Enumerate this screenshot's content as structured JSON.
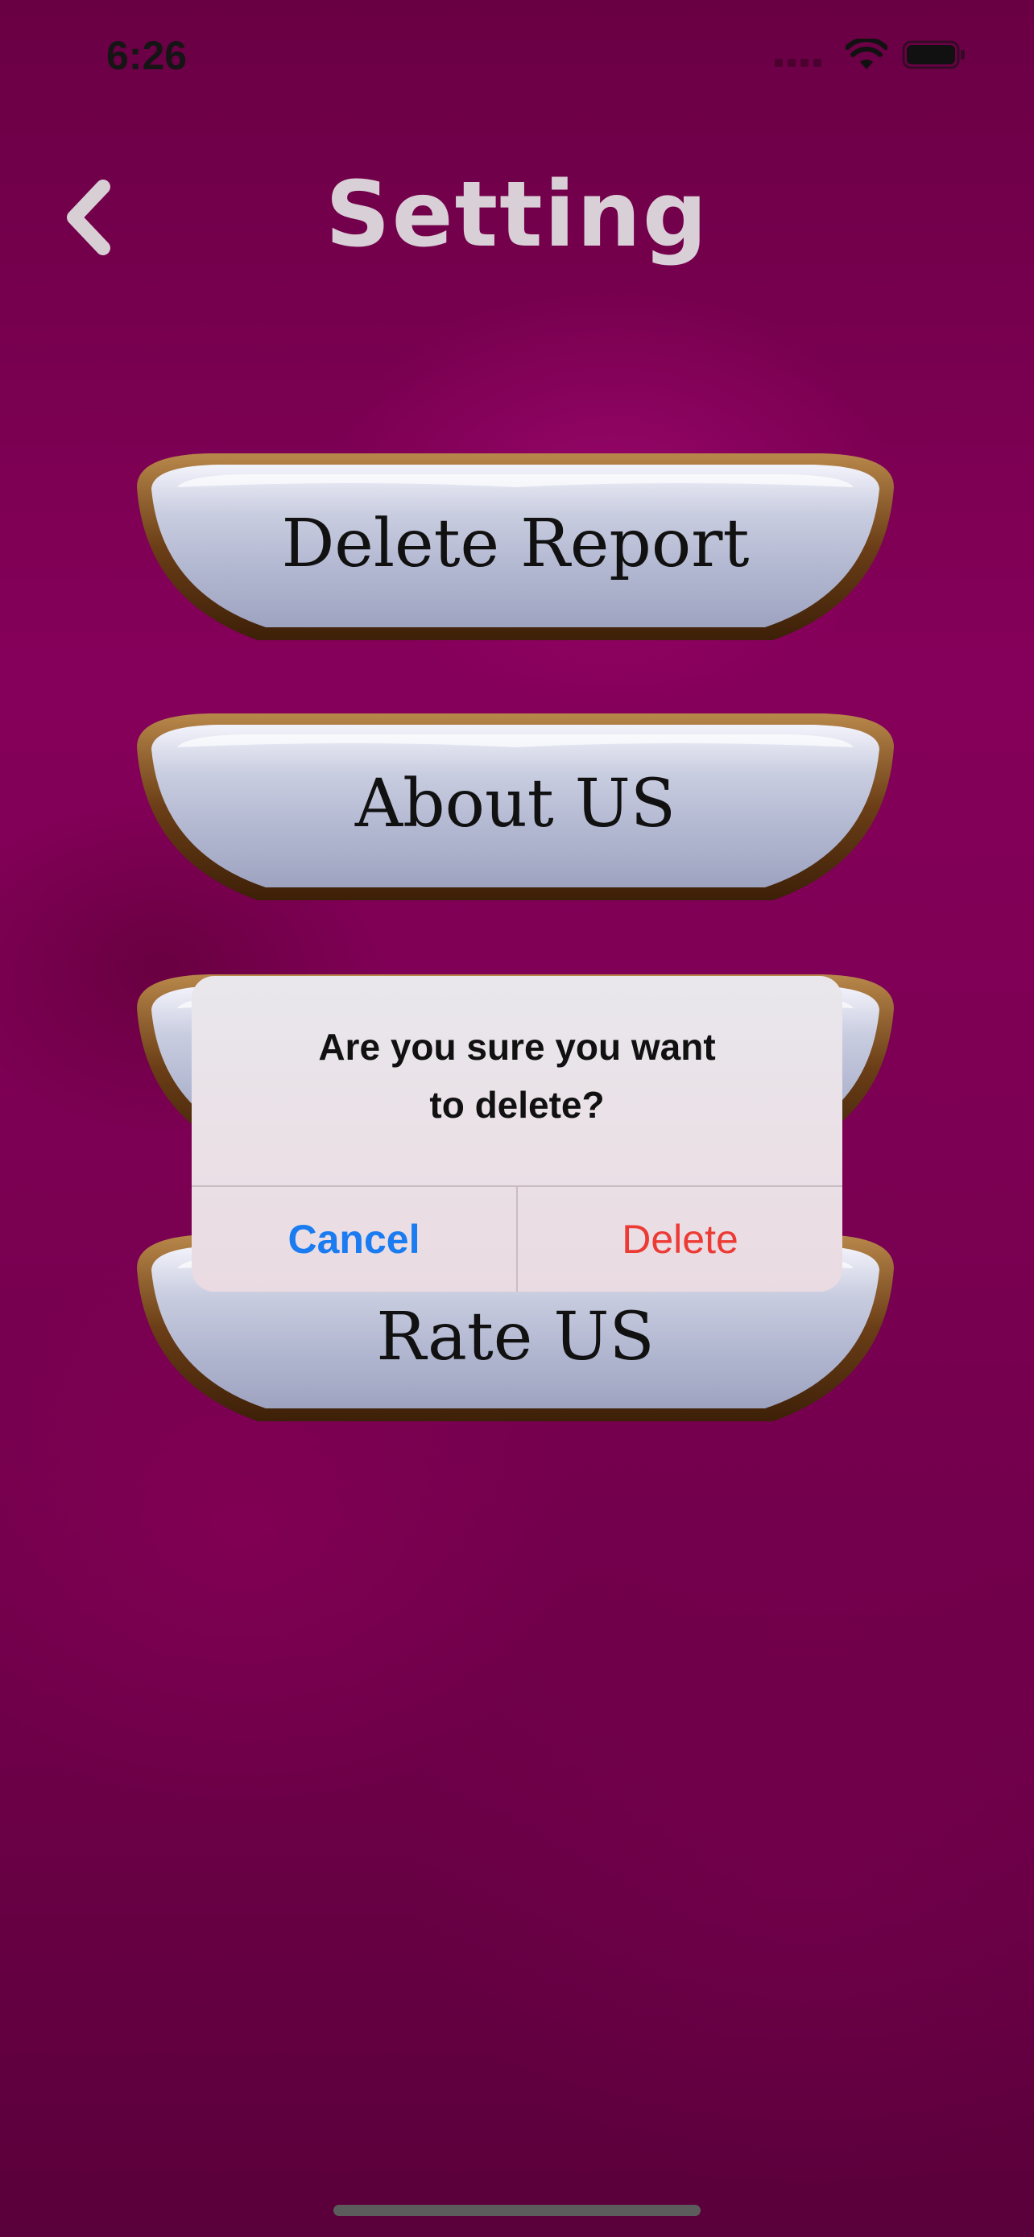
{
  "status_bar": {
    "time": "6:26"
  },
  "header": {
    "title": "Setting"
  },
  "menu": {
    "items": [
      {
        "label": "Delete Report"
      },
      {
        "label": "About US"
      },
      {
        "label": ""
      },
      {
        "label": "Rate US"
      }
    ]
  },
  "alert": {
    "message_line1": "Are you sure you want",
    "message_line2": "to delete?",
    "cancel_label": "Cancel",
    "delete_label": "Delete"
  },
  "colors": {
    "background": "#7a0052",
    "title": "#d9cfd6",
    "cancel": "#1a7cf0",
    "delete": "#ec3b35"
  }
}
